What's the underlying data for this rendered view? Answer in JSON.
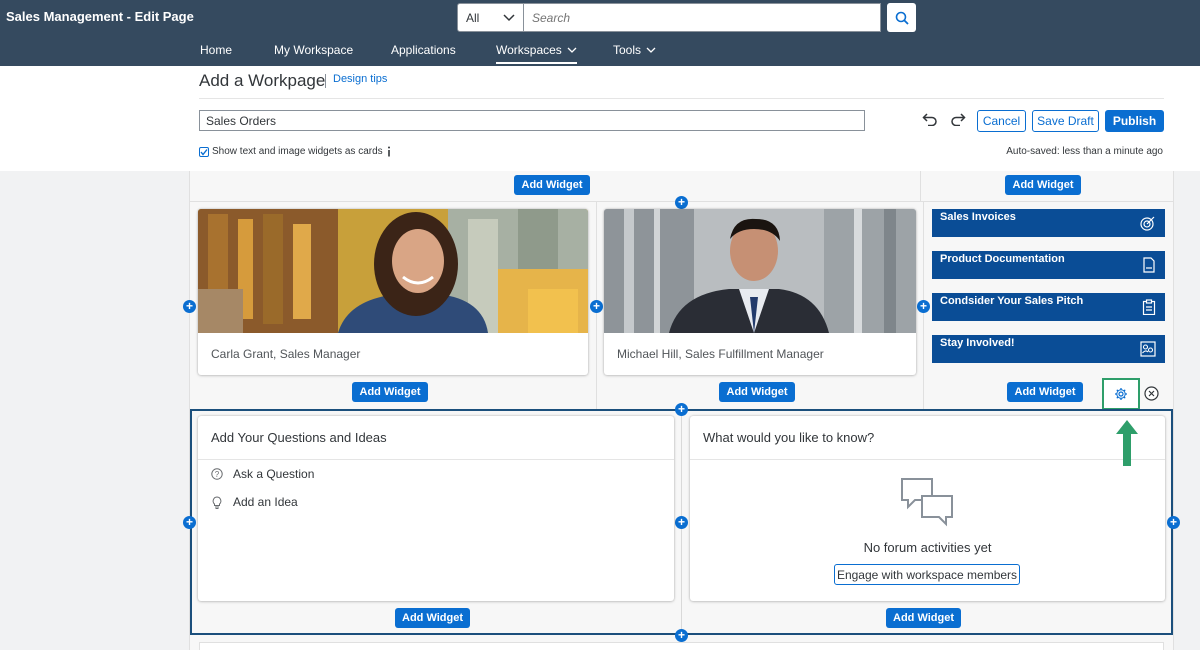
{
  "shell": {
    "title": "Sales Management - Edit Page",
    "search_scope": "All",
    "search_placeholder": "Search"
  },
  "nav": {
    "items": [
      {
        "label": "Home"
      },
      {
        "label": "My Workspace"
      },
      {
        "label": "Applications"
      },
      {
        "label": "Workspaces"
      },
      {
        "label": "Tools"
      }
    ]
  },
  "page": {
    "title": "Add a Workpage",
    "design_tips": "Design tips",
    "name_value": "Sales Orders",
    "cancel_label": "Cancel",
    "save_draft_label": "Save Draft",
    "publish_label": "Publish",
    "cards_checkbox_label": "Show text and image widgets as cards",
    "autosave_text": "Auto-saved: less than a minute ago"
  },
  "widgets": {
    "add_widget_label": "Add Widget",
    "image_cards": [
      {
        "caption": "Carla Grant, Sales Manager"
      },
      {
        "caption": "Michael Hill, Sales Fulfillment Manager"
      }
    ],
    "tiles": [
      {
        "label": "Sales Invoices",
        "icon": "target-icon"
      },
      {
        "label": "Product Documentation",
        "icon": "document-icon"
      },
      {
        "label": "Condsider Your Sales Pitch",
        "icon": "clipboard-icon"
      },
      {
        "label": "Stay Involved!",
        "icon": "people-icon"
      }
    ],
    "qa_card": {
      "title": "Add Your Questions and Ideas",
      "items": [
        {
          "label": "Ask a Question",
          "icon": "question-icon"
        },
        {
          "label": "Add an Idea",
          "icon": "lightbulb-icon"
        }
      ]
    },
    "forum_card": {
      "title": "What would you like to know?",
      "empty_text": "No forum activities yet",
      "engage_label": "Engage with workspace members"
    }
  },
  "colors": {
    "shell": "#354a5f",
    "accent": "#0a6ed1",
    "tile": "#0a4d96",
    "highlight": "#2e9e6a"
  }
}
